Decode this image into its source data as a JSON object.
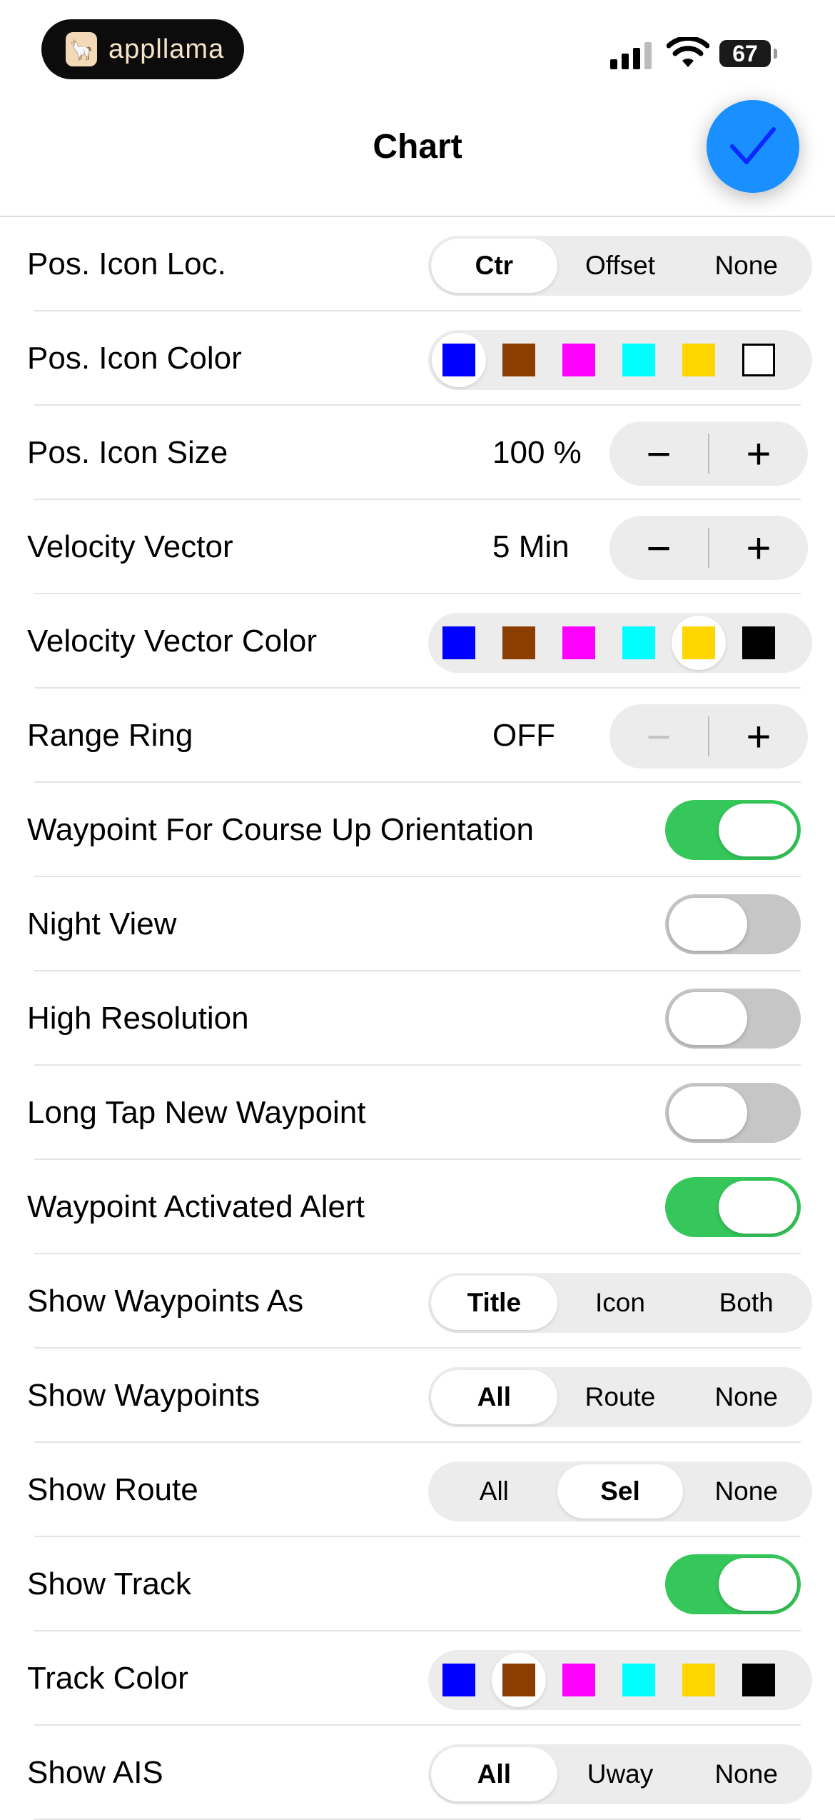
{
  "status_bar": {
    "app_badge": "appllama",
    "app_badge_icon": "llama-icon",
    "battery": "67",
    "signal_icon": "cellular-signal-icon",
    "wifi_icon": "wifi-icon"
  },
  "nav": {
    "title": "Chart",
    "done_icon": "checkmark-icon",
    "done_color": "#1a8fff"
  },
  "colors": {
    "blue": "#0000ff",
    "brown": "#8b3e00",
    "magenta": "#ff00ff",
    "cyan": "#00ffff",
    "yellow": "#ffd600",
    "black": "#000000",
    "white": "#ffffff",
    "toggle_on": "#35c759",
    "toggle_off": "#c6c6c6"
  },
  "settings": {
    "pos_icon_loc": {
      "label": "Pos. Icon Loc.",
      "options": [
        "Ctr",
        "Offset",
        "None"
      ],
      "selected": "Ctr"
    },
    "pos_icon_color": {
      "label": "Pos. Icon Color",
      "swatches": [
        "blue",
        "brown",
        "magenta",
        "cyan",
        "yellow",
        "white"
      ],
      "selected": "blue"
    },
    "pos_icon_size": {
      "label": "Pos. Icon Size",
      "value": "100 %"
    },
    "velocity_vector": {
      "label": "Velocity Vector",
      "value": "5 Min"
    },
    "velocity_vector_color": {
      "label": "Velocity Vector Color",
      "swatches": [
        "blue",
        "brown",
        "magenta",
        "cyan",
        "yellow",
        "black"
      ],
      "selected": "yellow"
    },
    "range_ring": {
      "label": "Range Ring",
      "value": "OFF",
      "minus_disabled": true
    },
    "waypoint_course_up": {
      "label": "Waypoint For Course Up Orientation",
      "on": true
    },
    "night_view": {
      "label": "Night View",
      "on": false
    },
    "high_resolution": {
      "label": "High Resolution",
      "on": false
    },
    "long_tap_new_waypoint": {
      "label": "Long Tap New Waypoint",
      "on": false
    },
    "waypoint_activated_alert": {
      "label": "Waypoint Activated Alert",
      "on": true
    },
    "show_waypoints_as": {
      "label": "Show Waypoints As",
      "options": [
        "Title",
        "Icon",
        "Both"
      ],
      "selected": "Title"
    },
    "show_waypoints": {
      "label": "Show Waypoints",
      "options": [
        "All",
        "Route",
        "None"
      ],
      "selected": "All"
    },
    "show_route": {
      "label": "Show Route",
      "options": [
        "All",
        "Sel",
        "None"
      ],
      "selected": "Sel"
    },
    "show_track": {
      "label": "Show Track",
      "on": true
    },
    "track_color": {
      "label": "Track Color",
      "swatches": [
        "blue",
        "brown",
        "magenta",
        "cyan",
        "yellow",
        "black"
      ],
      "selected": "brown"
    },
    "show_ais": {
      "label": "Show AIS",
      "options": [
        "All",
        "Uway",
        "None"
      ],
      "selected": "All"
    }
  },
  "stepper": {
    "minus": "−",
    "plus": "+"
  }
}
